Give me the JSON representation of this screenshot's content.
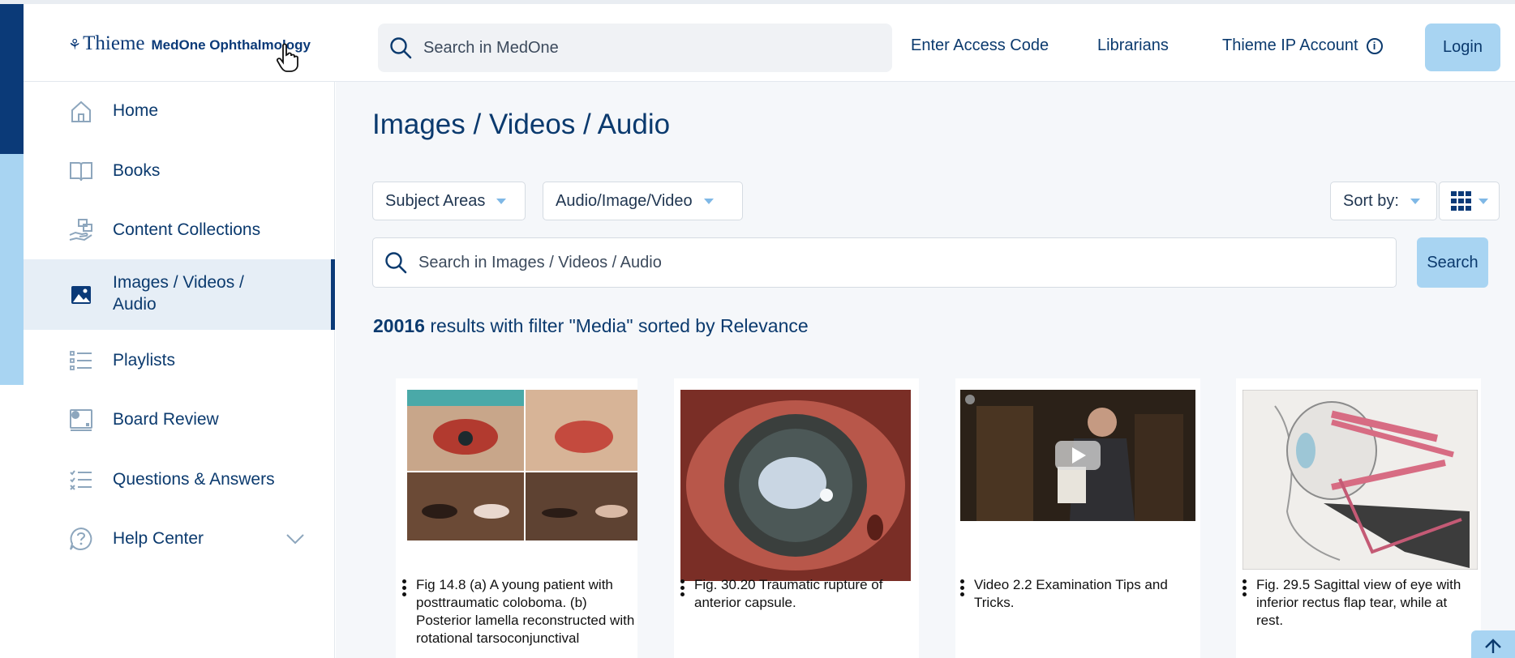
{
  "header": {
    "brand": "Thieme",
    "product": "MedOne Ophthalmology",
    "search_placeholder": "Search in MedOne",
    "links": {
      "access_code": "Enter Access Code",
      "librarians": "Librarians",
      "ip_account": "Thieme IP Account"
    },
    "info_glyph": "i",
    "login_label": "Login"
  },
  "sidebar": {
    "items": [
      {
        "label": "Home",
        "icon": "home-icon"
      },
      {
        "label": "Books",
        "icon": "book-icon"
      },
      {
        "label": "Content Collections",
        "icon": "collections-icon"
      },
      {
        "label": "Images / Videos / Audio",
        "label_line1": "Images / Videos /",
        "label_line2": "Audio",
        "icon": "image-icon",
        "active": true
      },
      {
        "label": "Playlists",
        "icon": "playlist-icon"
      },
      {
        "label": "Board Review",
        "icon": "board-review-icon"
      },
      {
        "label": "Questions & Answers",
        "icon": "questions-icon"
      },
      {
        "label": "Help Center",
        "icon": "help-icon",
        "expandable": true
      }
    ]
  },
  "main": {
    "title": "Images / Videos / Audio",
    "filters": {
      "subject_areas": "Subject Areas",
      "media_type": "Audio/Image/Video",
      "sort_by": "Sort by:"
    },
    "search_placeholder": "Search in Images / Videos / Audio",
    "search_button": "Search",
    "results": {
      "count": "20016",
      "text": " results with filter \"Media\" sorted by Relevance"
    },
    "cards": [
      {
        "caption": "Fig 14.8 (a) A young patient with posttraumatic coloboma. (b) Posterior lamella reconstructed with rotational tarsoconjunctival",
        "kind": "image"
      },
      {
        "caption": "Fig. 30.20 Traumatic rupture of anterior capsule.",
        "kind": "image"
      },
      {
        "caption": "Video 2.2 Examination Tips and Tricks.",
        "kind": "video"
      },
      {
        "caption": "Fig. 29.5 Sagittal view of eye with inferior rectus flap tear, while at rest.",
        "kind": "image"
      }
    ]
  },
  "colors": {
    "brand_dark": "#0b3a78",
    "accent_light": "#a8d4f2",
    "text": "#0b3a6e",
    "main_bg": "#f5f7fa"
  }
}
